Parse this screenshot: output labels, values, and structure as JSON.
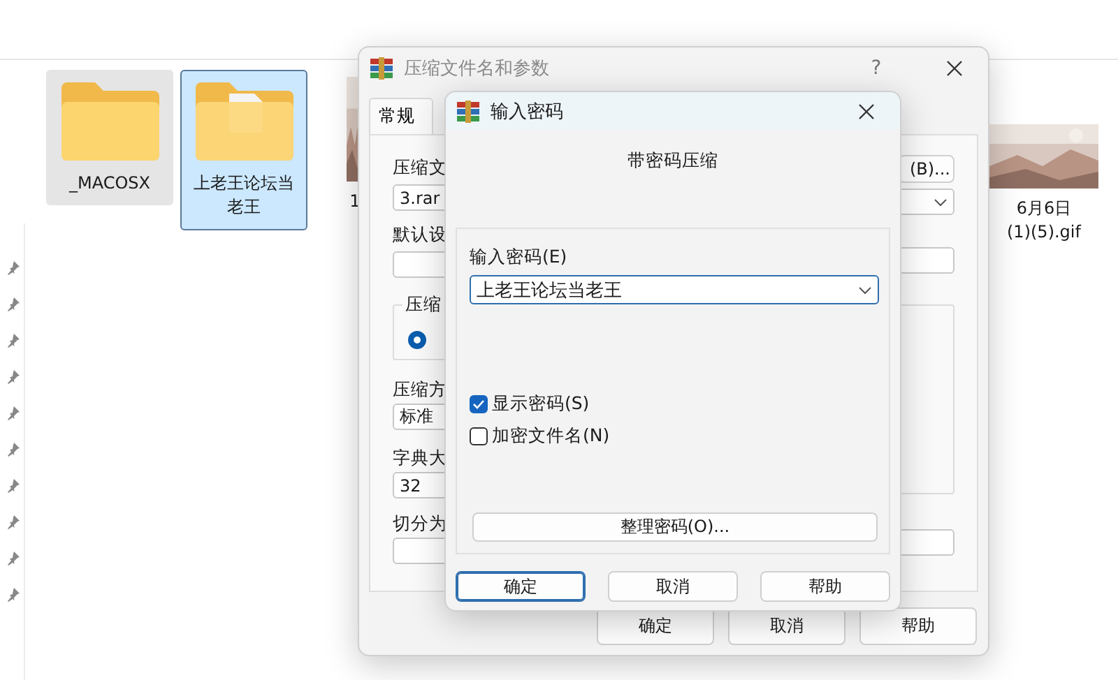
{
  "explorer": {
    "files": [
      {
        "kind": "folder",
        "name_lines": [
          "_MACOSX"
        ],
        "selected": false,
        "hovered": true
      },
      {
        "kind": "folder_with_files",
        "name_lines": [
          "上老王论坛当",
          "老王"
        ],
        "selected": true,
        "hovered": false
      },
      {
        "kind": "picture",
        "name_lines": [
          "1"
        ],
        "selected": false,
        "hovered": false
      },
      {
        "kind": "picture",
        "name_lines": [
          "6月6日",
          "(1)(5).gif"
        ],
        "selected": false,
        "hovered": false
      }
    ]
  },
  "archive_dialog": {
    "title": "压缩文件名和参数",
    "help": "?",
    "tabs": [
      {
        "label": "常规",
        "selected": true
      }
    ],
    "archive_label": "压缩文",
    "archive_value": "3.rar",
    "browse_button": "(B)...",
    "profile_label": "默认设",
    "group_label": "压缩",
    "radio_selected": true,
    "method_label": "压缩方",
    "method_value": "标准",
    "dictionary_label": "字典大",
    "dictionary_value": "32",
    "split_label": "切分为",
    "buttons": [
      {
        "label": "确定",
        "default": false
      },
      {
        "label": "取消",
        "default": false
      },
      {
        "label": "帮助",
        "default": false
      }
    ]
  },
  "password_dialog": {
    "title": "输入密码",
    "heading": "带密码压缩",
    "password_label": "输入密码(E)",
    "password_value": "上老王论坛当老王",
    "options": [
      {
        "label": "显示密码(S)",
        "checked": true
      },
      {
        "label": "加密文件名(N)",
        "checked": false
      }
    ],
    "organize_button": "整理密码(O)...",
    "buttons": [
      {
        "label": "确定",
        "default": true
      },
      {
        "label": "取消",
        "default": false
      },
      {
        "label": "帮助",
        "default": false
      }
    ]
  }
}
